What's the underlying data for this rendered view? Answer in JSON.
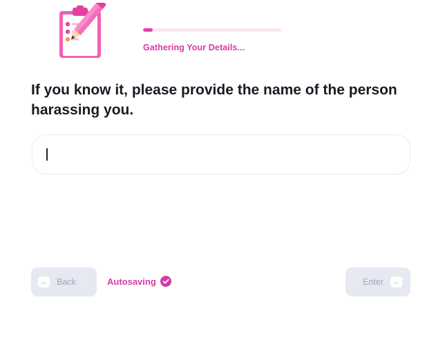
{
  "progress": {
    "label": "Gathering Your Details...",
    "fraction": 0.07
  },
  "question": {
    "text": "If you know it, please provide the name of the person harassing you."
  },
  "answer": {
    "value": "",
    "placeholder": ""
  },
  "nav": {
    "back_label": "Back",
    "back_icon": "arrow-left-icon",
    "enter_label": "Enter",
    "enter_icon": "arrow-right-icon",
    "back_key_glyph": "←",
    "enter_key_glyph": "→"
  },
  "autosave": {
    "label": "Autosaving",
    "icon": "check-circle-icon"
  },
  "colors": {
    "accent": "#e53fb4",
    "accent_text": "#d63aa6",
    "button_bg": "#e6e9f1",
    "button_text": "#a1a6b8",
    "heading": "#1a1a24"
  }
}
